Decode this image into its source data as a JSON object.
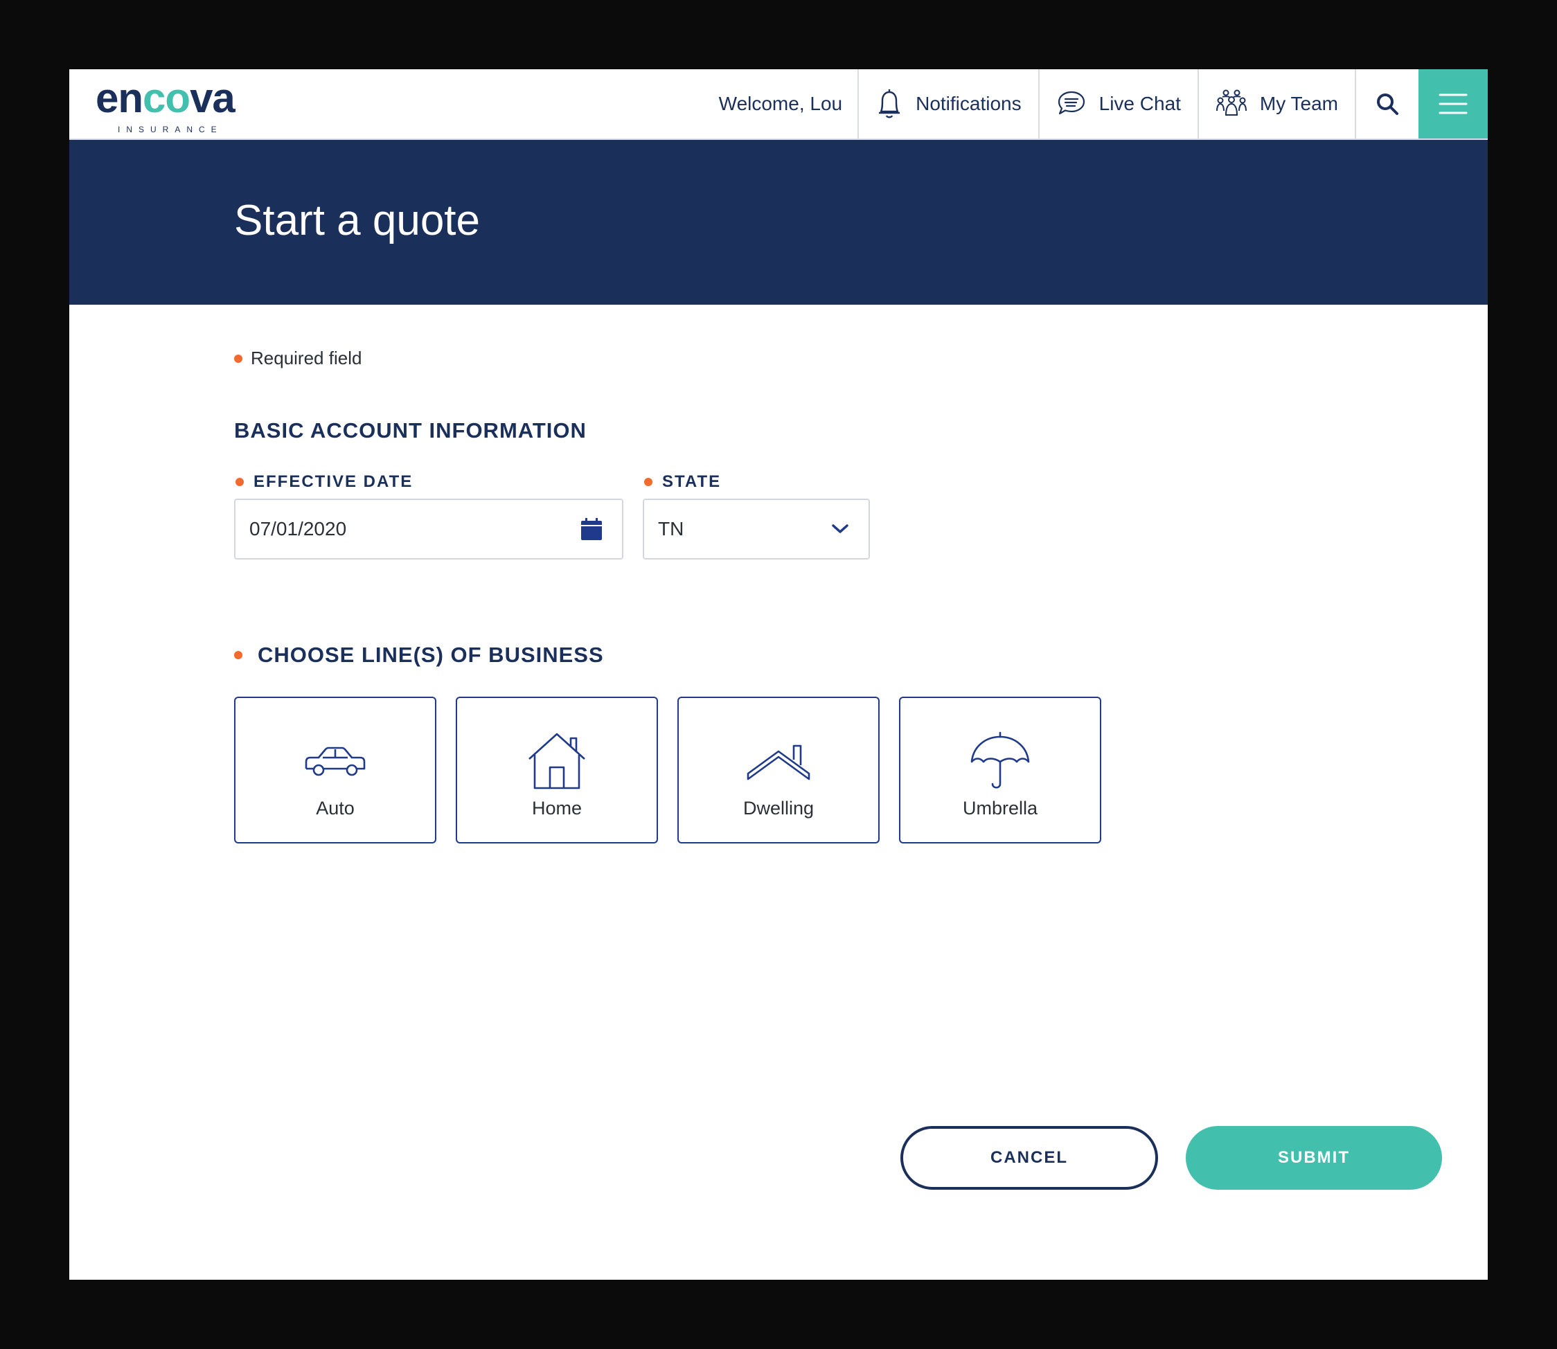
{
  "brand": {
    "logo_main_a": "en",
    "logo_main_b": "co",
    "logo_main_c": "va",
    "logo_sub": "INSURANCE",
    "accent": "#43c0ad",
    "navy": "#1b2f5b",
    "required_dot": "#f26a2e"
  },
  "nav": {
    "welcome": "Welcome, Lou",
    "notifications": "Notifications",
    "live_chat": "Live Chat",
    "my_team": "My Team",
    "icons": [
      "bell-icon",
      "chat-icon",
      "team-icon",
      "search-icon",
      "menu-icon"
    ]
  },
  "hero": {
    "title": "Start a quote"
  },
  "form": {
    "required_note": "Required field",
    "section_title": "BASIC ACCOUNT INFORMATION",
    "effective_date": {
      "label": "EFFECTIVE DATE",
      "value": "07/01/2020"
    },
    "state": {
      "label": "STATE",
      "value": "TN"
    },
    "lob_title": "CHOOSE LINE(S) OF BUSINESS",
    "lob_options": [
      {
        "label": "Auto",
        "icon": "car-icon"
      },
      {
        "label": "Home",
        "icon": "house-icon"
      },
      {
        "label": "Dwelling",
        "icon": "roof-icon"
      },
      {
        "label": "Umbrella",
        "icon": "umbrella-icon"
      }
    ]
  },
  "actions": {
    "cancel": "CANCEL",
    "submit": "SUBMIT"
  }
}
